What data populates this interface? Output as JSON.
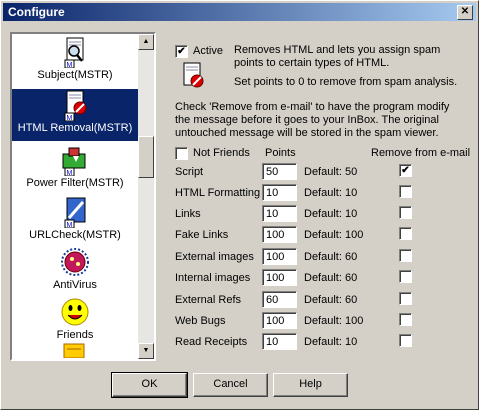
{
  "window": {
    "title": "Configure",
    "close_glyph": "✕"
  },
  "sidebar": {
    "items": [
      {
        "label": "Subject(MSTR)",
        "icon": "document-magnifier-icon",
        "selected": false
      },
      {
        "label": "HTML Removal(MSTR)",
        "icon": "document-no-icon",
        "selected": true
      },
      {
        "label": "Power Filter(MSTR)",
        "icon": "power-filter-icon",
        "selected": false
      },
      {
        "label": "URLCheck(MSTR)",
        "icon": "url-check-icon",
        "selected": false
      },
      {
        "label": "AntiVirus",
        "icon": "virus-icon",
        "selected": false
      },
      {
        "label": "Friends",
        "icon": "smiley-icon",
        "selected": false
      }
    ]
  },
  "main": {
    "active_label": "Active",
    "active_checked": true,
    "active_description": "Removes HTML and lets you assign spam points to certain types of HTML.",
    "zero_note": "Set points to 0 to remove from spam analysis.",
    "remove_note": "Check 'Remove from e-mail' to have the program modify the message before it goes to your InBox.  The original untouched message will be stored in the spam viewer.",
    "not_friends_label": "Not Friends",
    "not_friends_checked": false,
    "points_header": "Points",
    "remove_header": "Remove from e-mail",
    "rows": [
      {
        "label": "Script",
        "points": "50",
        "default": "Default: 50",
        "remove": true
      },
      {
        "label": "HTML Formatting",
        "points": "10",
        "default": "Default: 10",
        "remove": false
      },
      {
        "label": "Links",
        "points": "10",
        "default": "Default: 10",
        "remove": false
      },
      {
        "label": "Fake Links",
        "points": "100",
        "default": "Default: 100",
        "remove": false
      },
      {
        "label": "External images",
        "points": "100",
        "default": "Default: 60",
        "remove": false
      },
      {
        "label": "Internal images",
        "points": "100",
        "default": "Default: 60",
        "remove": false
      },
      {
        "label": "External Refs",
        "points": "60",
        "default": "Default: 60",
        "remove": false
      },
      {
        "label": "Web Bugs",
        "points": "100",
        "default": "Default: 100",
        "remove": false
      },
      {
        "label": "Read Receipts",
        "points": "10",
        "default": "Default: 10",
        "remove": false
      }
    ]
  },
  "buttons": {
    "ok": "OK",
    "cancel": "Cancel",
    "help": "Help"
  },
  "colors": {
    "title_active": "#0a246a",
    "face": "#d4d0c8",
    "selection": "#0a246a"
  }
}
